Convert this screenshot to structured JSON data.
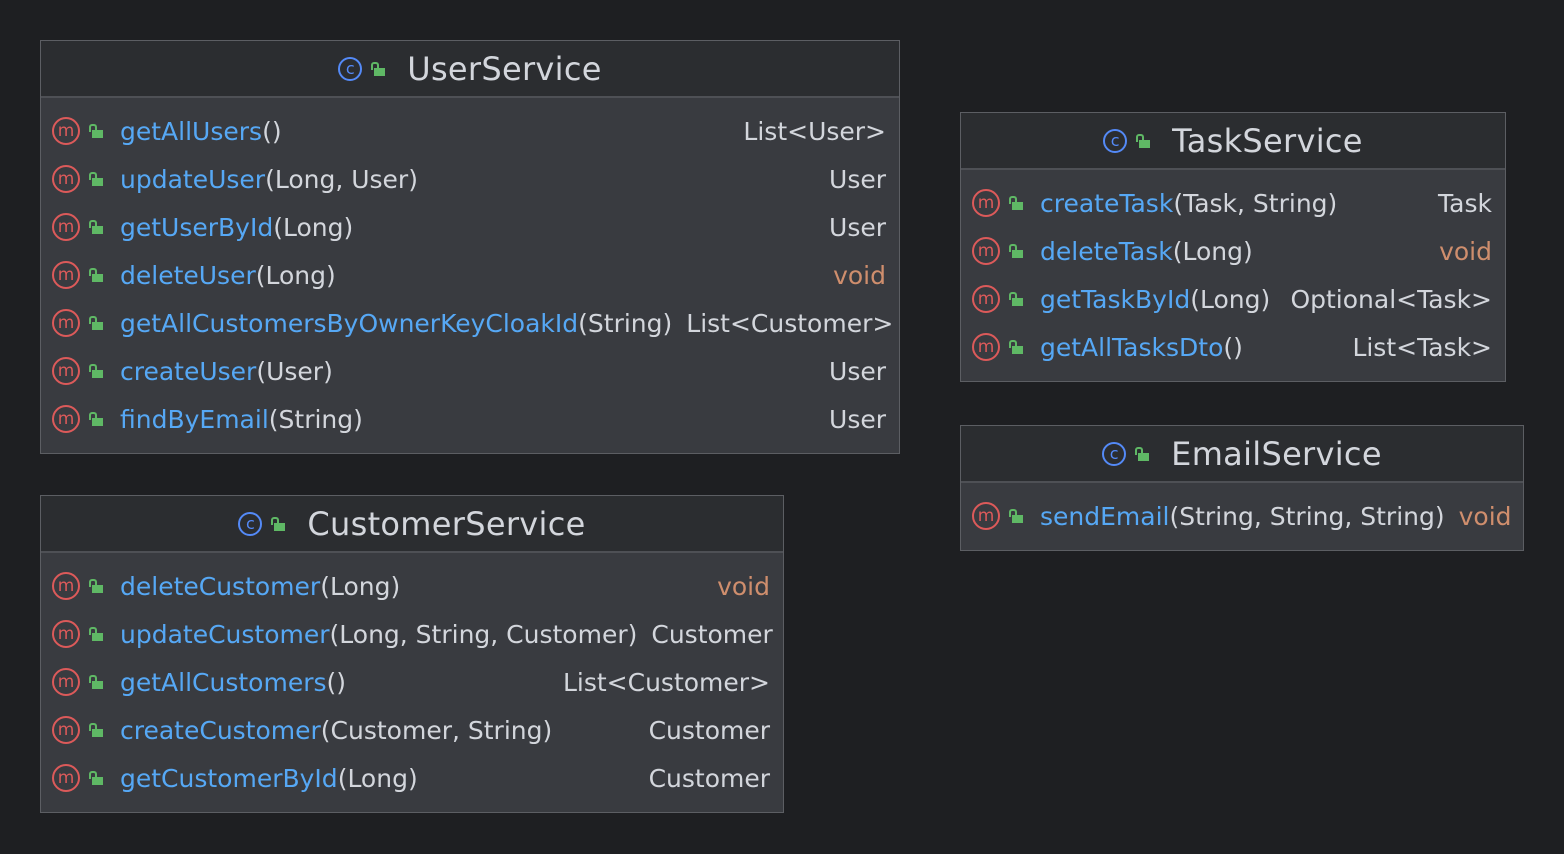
{
  "colors": {
    "background": "#1e1f22",
    "box": "#393b40",
    "header": "#2b2d30",
    "method_name": "#56a8f5",
    "keyword": "#cf8e6d",
    "text": "#d3d6dc",
    "class_icon": "#548af7",
    "method_icon": "#dc5a5a",
    "visibility_icon": "#5fb865"
  },
  "icons": {
    "class": "c-circle-icon",
    "method": "m-circle-icon",
    "visibility": "public-lock-icon",
    "class_glyph": "c",
    "method_glyph": "m"
  },
  "classes": {
    "user_service": {
      "name": "UserService",
      "methods": [
        {
          "name": "getAllUsers",
          "params": "()",
          "returns": "List<User>"
        },
        {
          "name": "updateUser",
          "params": "(Long, User)",
          "returns": "User"
        },
        {
          "name": "getUserById",
          "params": "(Long)",
          "returns": "User"
        },
        {
          "name": "deleteUser",
          "params": "(Long)",
          "returns": "void"
        },
        {
          "name": "getAllCustomersByOwnerKeyCloakId",
          "params": "(String)",
          "returns": "List<Customer>"
        },
        {
          "name": "createUser",
          "params": "(User)",
          "returns": "User"
        },
        {
          "name": "findByEmail",
          "params": "(String)",
          "returns": "User"
        }
      ]
    },
    "customer_service": {
      "name": "CustomerService",
      "methods": [
        {
          "name": "deleteCustomer",
          "params": "(Long)",
          "returns": "void"
        },
        {
          "name": "updateCustomer",
          "params": "(Long, String, Customer)",
          "returns": "Customer"
        },
        {
          "name": "getAllCustomers",
          "params": "()",
          "returns": "List<Customer>"
        },
        {
          "name": "createCustomer",
          "params": "(Customer, String)",
          "returns": "Customer"
        },
        {
          "name": "getCustomerById",
          "params": "(Long)",
          "returns": "Customer"
        }
      ]
    },
    "task_service": {
      "name": "TaskService",
      "methods": [
        {
          "name": "createTask",
          "params": "(Task, String)",
          "returns": "Task"
        },
        {
          "name": "deleteTask",
          "params": "(Long)",
          "returns": "void"
        },
        {
          "name": "getTaskById",
          "params": "(Long)",
          "returns": "Optional<Task>"
        },
        {
          "name": "getAllTasksDto",
          "params": "()",
          "returns": "List<Task>"
        }
      ]
    },
    "email_service": {
      "name": "EmailService",
      "methods": [
        {
          "name": "sendEmail",
          "params": "(String, String, String)",
          "returns": "void"
        }
      ]
    }
  }
}
